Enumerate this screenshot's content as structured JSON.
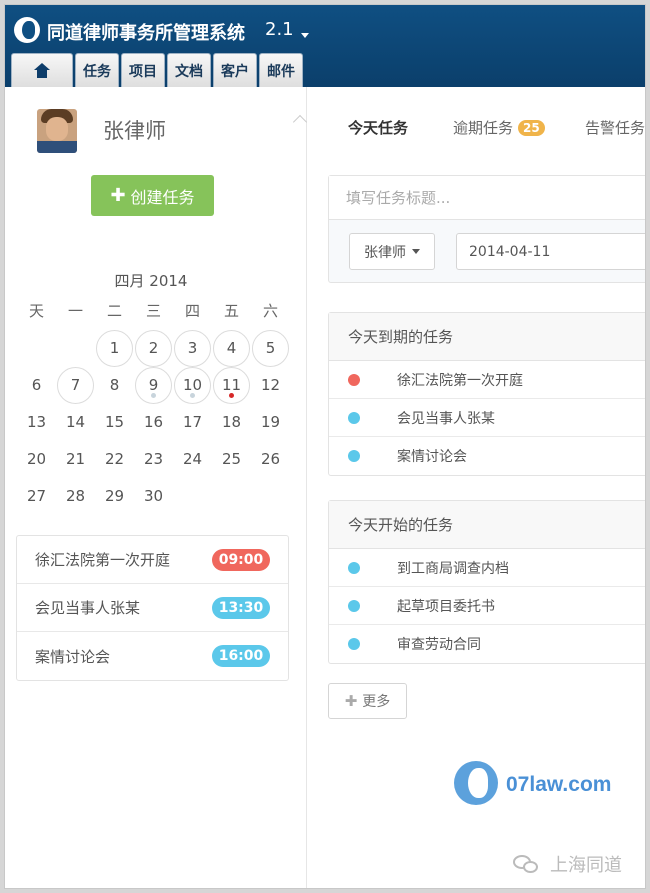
{
  "app": {
    "title": "同道律师事务所管理系统",
    "version": "2.1"
  },
  "nav": {
    "tabs": [
      "任务",
      "项目",
      "文档",
      "客户",
      "邮件"
    ]
  },
  "user": {
    "name": "张律师"
  },
  "sidebar": {
    "create_task_label": "创建任务"
  },
  "calendar": {
    "title": "四月 2014",
    "weekdays": [
      "天",
      "一",
      "二",
      "三",
      "四",
      "五",
      "六"
    ],
    "days": [
      "1",
      "2",
      "3",
      "4",
      "5",
      "6",
      "7",
      "8",
      "9",
      "10",
      "11",
      "12",
      "13",
      "14",
      "15",
      "16",
      "17",
      "18",
      "19",
      "20",
      "21",
      "22",
      "23",
      "24",
      "25",
      "26",
      "27",
      "28",
      "29",
      "30"
    ]
  },
  "agenda": [
    {
      "text": "徐汇法院第一次开庭",
      "time": "09:00",
      "color": "#f0675d"
    },
    {
      "text": "会见当事人张某",
      "time": "13:30",
      "color": "#5bc8ea"
    },
    {
      "text": "案情讨论会",
      "time": "16:00",
      "color": "#5bc8ea"
    }
  ],
  "main_tabs": [
    {
      "label": "今天任务"
    },
    {
      "label": "逾期任务",
      "count": "25"
    },
    {
      "label": "告警任务"
    }
  ],
  "task_form": {
    "title_placeholder": "填写任务标题...",
    "assignee": "张律师",
    "date": "2014-04-11"
  },
  "due_today": {
    "title": "今天到期的任务",
    "items": [
      {
        "text": "徐汇法院第一次开庭",
        "color": "#f0675d"
      },
      {
        "text": "会见当事人张某",
        "color": "#5bc8ea"
      },
      {
        "text": "案情讨论会",
        "color": "#5bc8ea"
      }
    ]
  },
  "start_today": {
    "title": "今天开始的任务",
    "items": [
      {
        "text": "到工商局调查内档",
        "color": "#5bc8ea"
      },
      {
        "text": "起草项目委托书",
        "color": "#5bc8ea"
      },
      {
        "text": "审查劳动合同",
        "color": "#5bc8ea"
      }
    ]
  },
  "more_label": "更多",
  "watermark": {
    "site": "07law.com",
    "wechat": "上海同道"
  }
}
